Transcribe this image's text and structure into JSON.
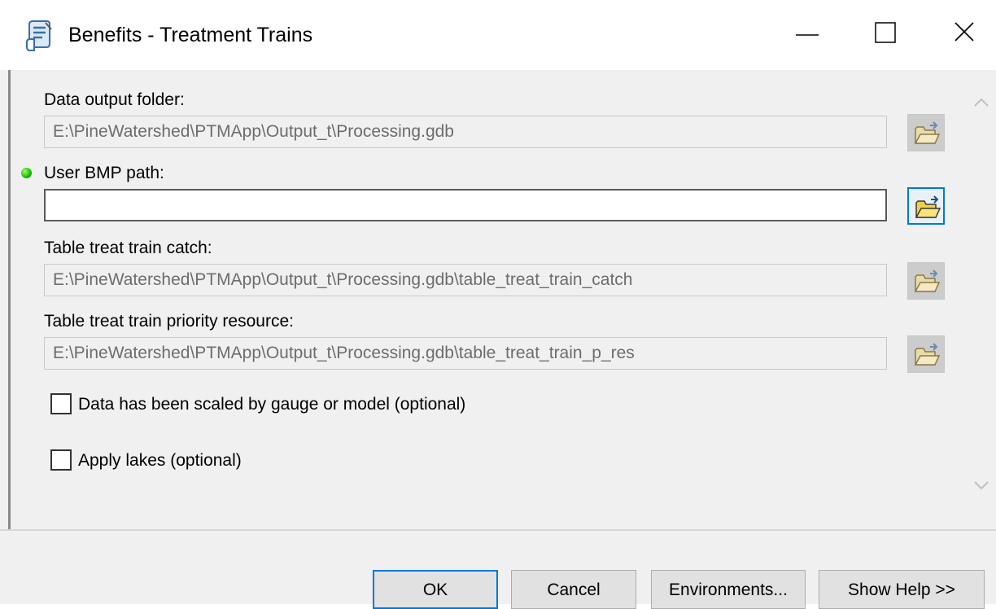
{
  "window": {
    "title": "Benefits - Treatment Trains",
    "icon": "python-script-icon",
    "controls": [
      "minimize-icon",
      "maximize-icon",
      "close-icon"
    ]
  },
  "params": {
    "data_output_folder": {
      "label": "Data output folder:",
      "value": "E:\\PineWatershed\\PTMApp\\Output_t\\Processing.gdb"
    },
    "user_bmp_path": {
      "label": "User BMP path:",
      "value": "",
      "required_indicator": "green-dot"
    },
    "table_treat_train_catch": {
      "label": "Table treat train catch:",
      "value": "E:\\PineWatershed\\PTMApp\\Output_t\\Processing.gdb\\table_treat_train_catch"
    },
    "table_treat_train_priority": {
      "label": "Table treat train priority resource:",
      "value": "E:\\PineWatershed\\PTMApp\\Output_t\\Processing.gdb\\table_treat_train_p_res"
    },
    "scaled_checkbox": {
      "label": "Data has been scaled by gauge or model (optional)",
      "checked": false
    },
    "apply_lakes_checkbox": {
      "label": "Apply lakes (optional)",
      "checked": false
    }
  },
  "buttons": {
    "ok": "OK",
    "cancel": "Cancel",
    "environments": "Environments...",
    "show_help": "Show Help >>"
  },
  "colors": {
    "accent": "#0078d7",
    "required_dot": "#17b800",
    "panel": "#f0f0f0"
  }
}
